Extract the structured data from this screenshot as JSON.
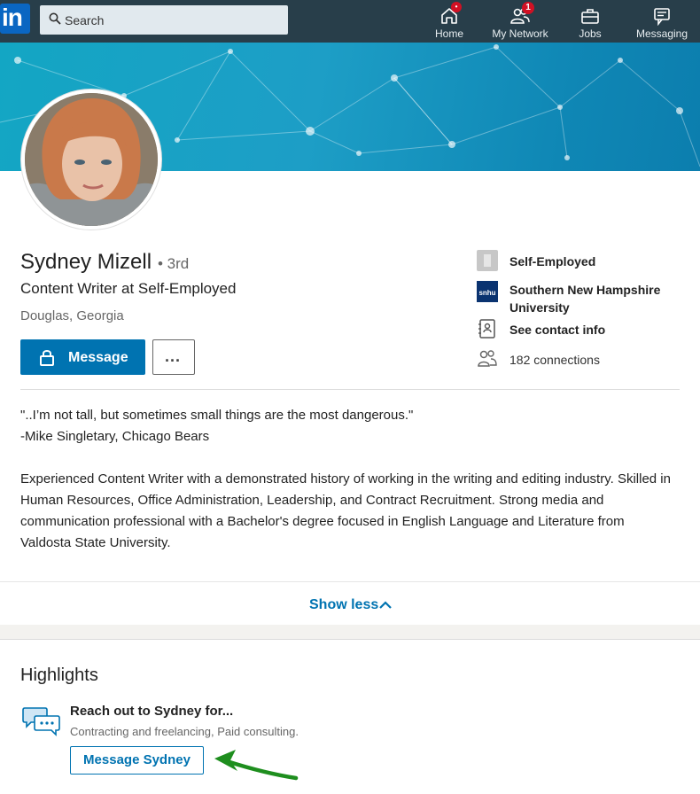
{
  "nav": {
    "search_placeholder": "Search",
    "items": [
      {
        "label": "Home",
        "icon": "home-icon",
        "badge": ""
      },
      {
        "label": "My Network",
        "icon": "network-icon",
        "badge": "1"
      },
      {
        "label": "Jobs",
        "icon": "briefcase-icon",
        "badge": ""
      },
      {
        "label": "Messaging",
        "icon": "messaging-icon",
        "badge": ""
      }
    ],
    "colors": {
      "bar": "#283e4a",
      "badge": "#d11124",
      "logo": "#0a66c2"
    }
  },
  "profile": {
    "name": "Sydney Mizell",
    "degree": "• 3rd",
    "headline": "Content Writer at Self-Employed",
    "location": "Douglas, Georgia",
    "message_label": "Message",
    "more_label": "...",
    "side": {
      "company": "Self-Employed",
      "school": "Southern New Hampshire University",
      "contact": "See contact info",
      "connections": "182 connections"
    },
    "summary_quote": [
      "\"..I’m not tall, but sometimes small things are the most dangerous.\"",
      "-Mike Singletary, Chicago Bears"
    ],
    "summary_body": "Experienced Content Writer with a demonstrated history of working in the writing and editing industry. Skilled in Human Resources, Office Administration, Leadership, and Contract Recruitment. Strong media and communication professional with a Bachelor's degree focused in English Language and Literature from Valdosta State University.",
    "show_less": "Show less"
  },
  "highlights": {
    "title": "Highlights",
    "heading": "Reach out to Sydney for...",
    "sub": "Contracting and freelancing, Paid consulting.",
    "button": "Message Sydney",
    "accent": "#0073b1",
    "arrow_color": "#1e8e1e"
  }
}
